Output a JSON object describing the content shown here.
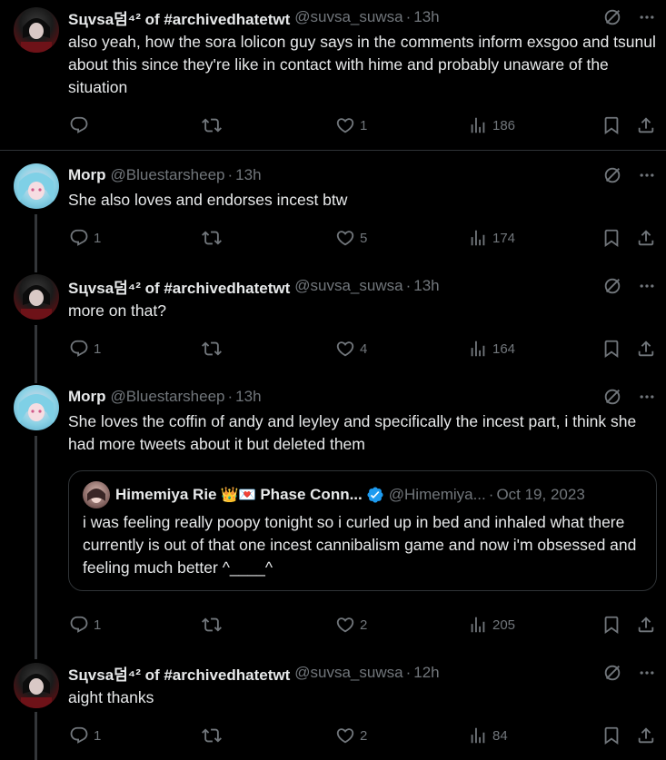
{
  "tweets": [
    {
      "display_name": "Sцvsa덤⁴² of #archivedhatetwt",
      "handle": "@suvsa_suwsa",
      "time": "13h",
      "text": "also yeah, how the sora lolicon guy says in the comments inform exsgoo and tsunul about this since they're like in contact with hime and probably unaware of the situation",
      "replies": "",
      "retweets": "",
      "likes": "1",
      "views": "186"
    },
    {
      "display_name": "Morp",
      "handle": "@Bluestarsheep",
      "time": "13h",
      "text": "She also loves and endorses incest btw",
      "replies": "1",
      "retweets": "",
      "likes": "5",
      "views": "174"
    },
    {
      "display_name": "Sцvsa덤⁴² of #archivedhatetwt",
      "handle": "@suvsa_suwsa",
      "time": "13h",
      "text": "more on that?",
      "replies": "1",
      "retweets": "",
      "likes": "4",
      "views": "164"
    },
    {
      "display_name": "Morp",
      "handle": "@Bluestarsheep",
      "time": "13h",
      "text": "She loves the coffin of andy and leyley and specifically the incest part, i think she had more tweets about it but deleted them",
      "replies": "1",
      "retweets": "",
      "likes": "2",
      "views": "205",
      "quote": {
        "display_name": "Himemiya Rie",
        "emoji": "👑💌",
        "name_suffix": "Phase Conn...",
        "handle": "@Himemiya...",
        "date": "Oct 19, 2023",
        "text": "i was feeling really poopy tonight so i curled up in bed and inhaled what there currently is out of that one incest cannibalism game and now i'm obsessed and feeling much better ^____^"
      }
    },
    {
      "display_name": "Sцvsa덤⁴² of #archivedhatetwt",
      "handle": "@suvsa_suwsa",
      "time": "12h",
      "text": "aight thanks",
      "replies": "1",
      "retweets": "",
      "likes": "2",
      "views": "84"
    }
  ],
  "separator": "·",
  "icons": {
    "grok": "grok-icon",
    "more": "more-icon",
    "reply": "reply-icon",
    "retweet": "retweet-icon",
    "like": "like-icon",
    "views": "views-icon",
    "bookmark": "bookmark-icon",
    "share": "share-icon",
    "verified": "verified-badge-icon"
  },
  "colors": {
    "background": "#000000",
    "text": "#e7e9ea",
    "muted": "#71767b",
    "verified": "#1d9bf0",
    "border": "#2f3336"
  }
}
